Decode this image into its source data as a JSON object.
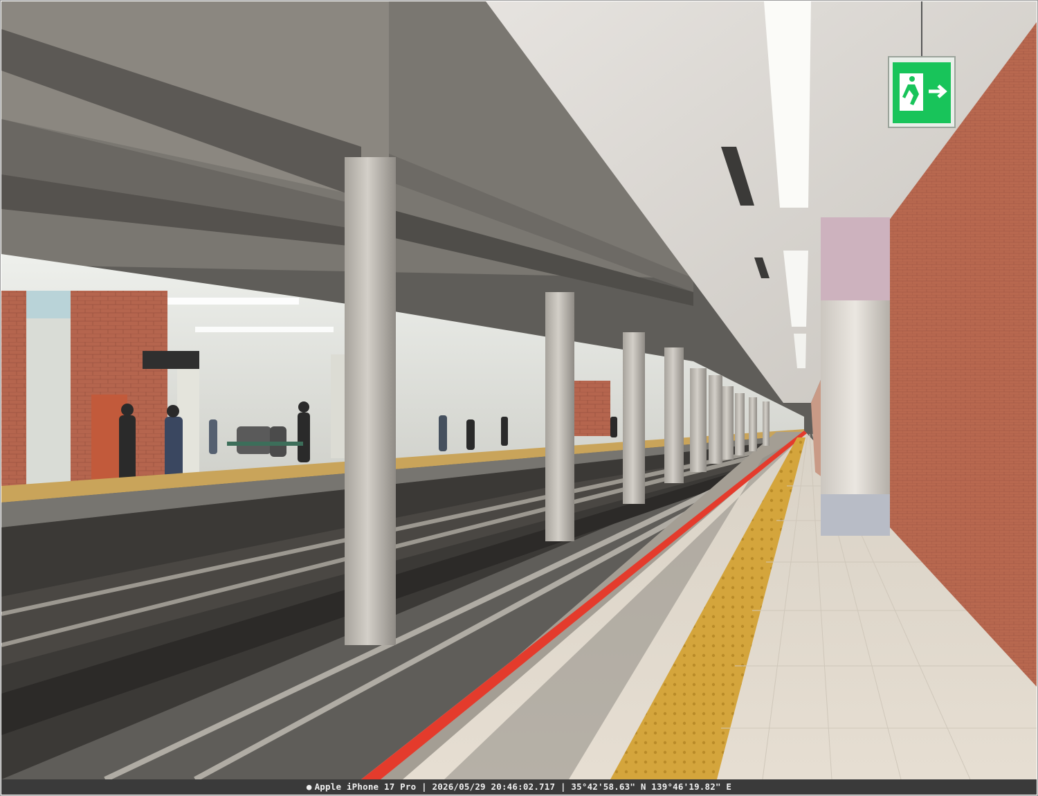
{
  "photo": {
    "scene": "Underground train station platform",
    "exit_sign_icon": "running-man-exit-icon",
    "colors": {
      "tile_wall": "#b5654e",
      "safety_line": "#e43b2c",
      "tactile_paving": "#d4a53c",
      "exit_sign": "#18c45a",
      "ceiling": "#d9d6d2",
      "concrete": "#8e8b85"
    }
  },
  "caption": {
    "text": "Apple iPhone 17 Pro | 2026/05/29 20:46:02.717 | 35°42'58.63\" N 139°46'19.82\" E"
  }
}
